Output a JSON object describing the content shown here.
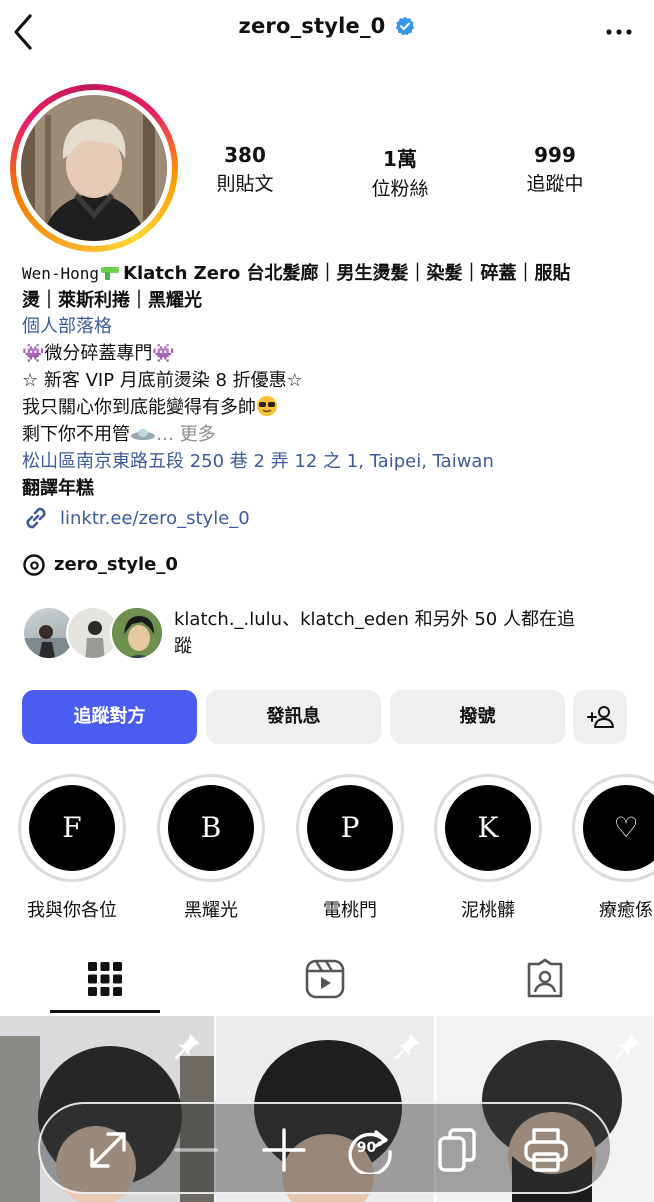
{
  "header": {
    "username": "zero_style_0"
  },
  "stats": [
    {
      "value": "380",
      "label": "則貼文"
    },
    {
      "value": "1萬",
      "label": "位粉絲"
    },
    {
      "value": "999",
      "label": "追蹤中"
    }
  ],
  "bio": {
    "name_prefix": "Wen-Hong",
    "name_line1": "Klatch Zero 台北髮廊｜男生燙髮｜染髮｜碎蓋｜服貼",
    "name_line2": "燙｜萊斯利捲｜黑耀光",
    "category": "個人部落格",
    "line_a": "微分碎蓋專門",
    "line_b": "☆ 新客 VIP 月底前燙染 8 折優惠☆",
    "line_c": "我只關心你到底能變得有多帥",
    "line_d": "剩下你不用管",
    "more": "… 更多",
    "address": "松山區南京東路五段 250 巷 2 弄 12 之 1, Taipei, Taiwan",
    "translate": "翻譯年糕",
    "link": "linktr.ee/zero_style_0",
    "threads": "zero_style_0"
  },
  "followed_by": {
    "line1": "klatch._.lulu、klatch_eden 和另外 50 人都在追",
    "line2": "蹤"
  },
  "buttons": {
    "follow": "追蹤對方",
    "message": "發訊息",
    "call": "撥號"
  },
  "highlights": [
    {
      "letter": "F",
      "label": "我與你各位"
    },
    {
      "letter": "B",
      "label": "黑耀光"
    },
    {
      "letter": "P",
      "label": "電桃門"
    },
    {
      "letter": "K",
      "label": "泥桃髒"
    },
    {
      "letter": "♡",
      "label": "療癒係"
    }
  ],
  "toolbar": {
    "rotate_label": "90°"
  }
}
